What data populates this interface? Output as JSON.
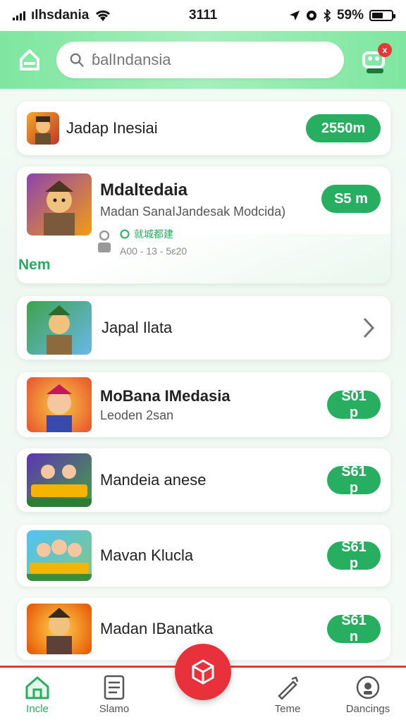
{
  "status_bar": {
    "carrier": "ılhsdania",
    "time": "3111",
    "battery": "59%",
    "battery_level": 0.59
  },
  "header": {
    "search_placeholder": "ɓalIndansia",
    "notification_count": "x"
  },
  "colors": {
    "accent": "#27ae60",
    "header_bg": "#8ee9ad",
    "fab": "#e8313a",
    "badge": "#e53935"
  },
  "cards": [
    {
      "title": "Jadap Inesiai",
      "button": "2550m",
      "icon": "warrior-icon"
    },
    {
      "title": "Mdaltedaia",
      "subtitle": "Madan SanaIJandesak Modcida)",
      "meta_tag": "就城都建",
      "meta_date": "A00 - 13 - 5ɛ20",
      "tag": "Nem",
      "button": "S5 m",
      "icon": "warrior-icon"
    },
    {
      "title": "Japal Ilata",
      "icon": "warrior-icon"
    },
    {
      "title": "MoBana IMedasia",
      "subtitle": "Leoden 2san",
      "button": "S01 p",
      "icon": "character-icon"
    },
    {
      "title": "Mandeia anese",
      "button": "S61 p",
      "icon": "game-logo-icon"
    },
    {
      "title": "Mavan Klucla",
      "button": "S61 p",
      "icon": "group-icon"
    },
    {
      "title": "Madan IBanatka",
      "button": "S61 n",
      "icon": "warrior-icon"
    }
  ],
  "bottom_nav": {
    "items": [
      {
        "label": "Incle",
        "icon": "home-icon"
      },
      {
        "label": "Slamo",
        "icon": "document-icon"
      },
      {
        "label": "Teme",
        "icon": "brush-icon"
      },
      {
        "label": "Dancings",
        "icon": "circle-icon"
      }
    ]
  }
}
